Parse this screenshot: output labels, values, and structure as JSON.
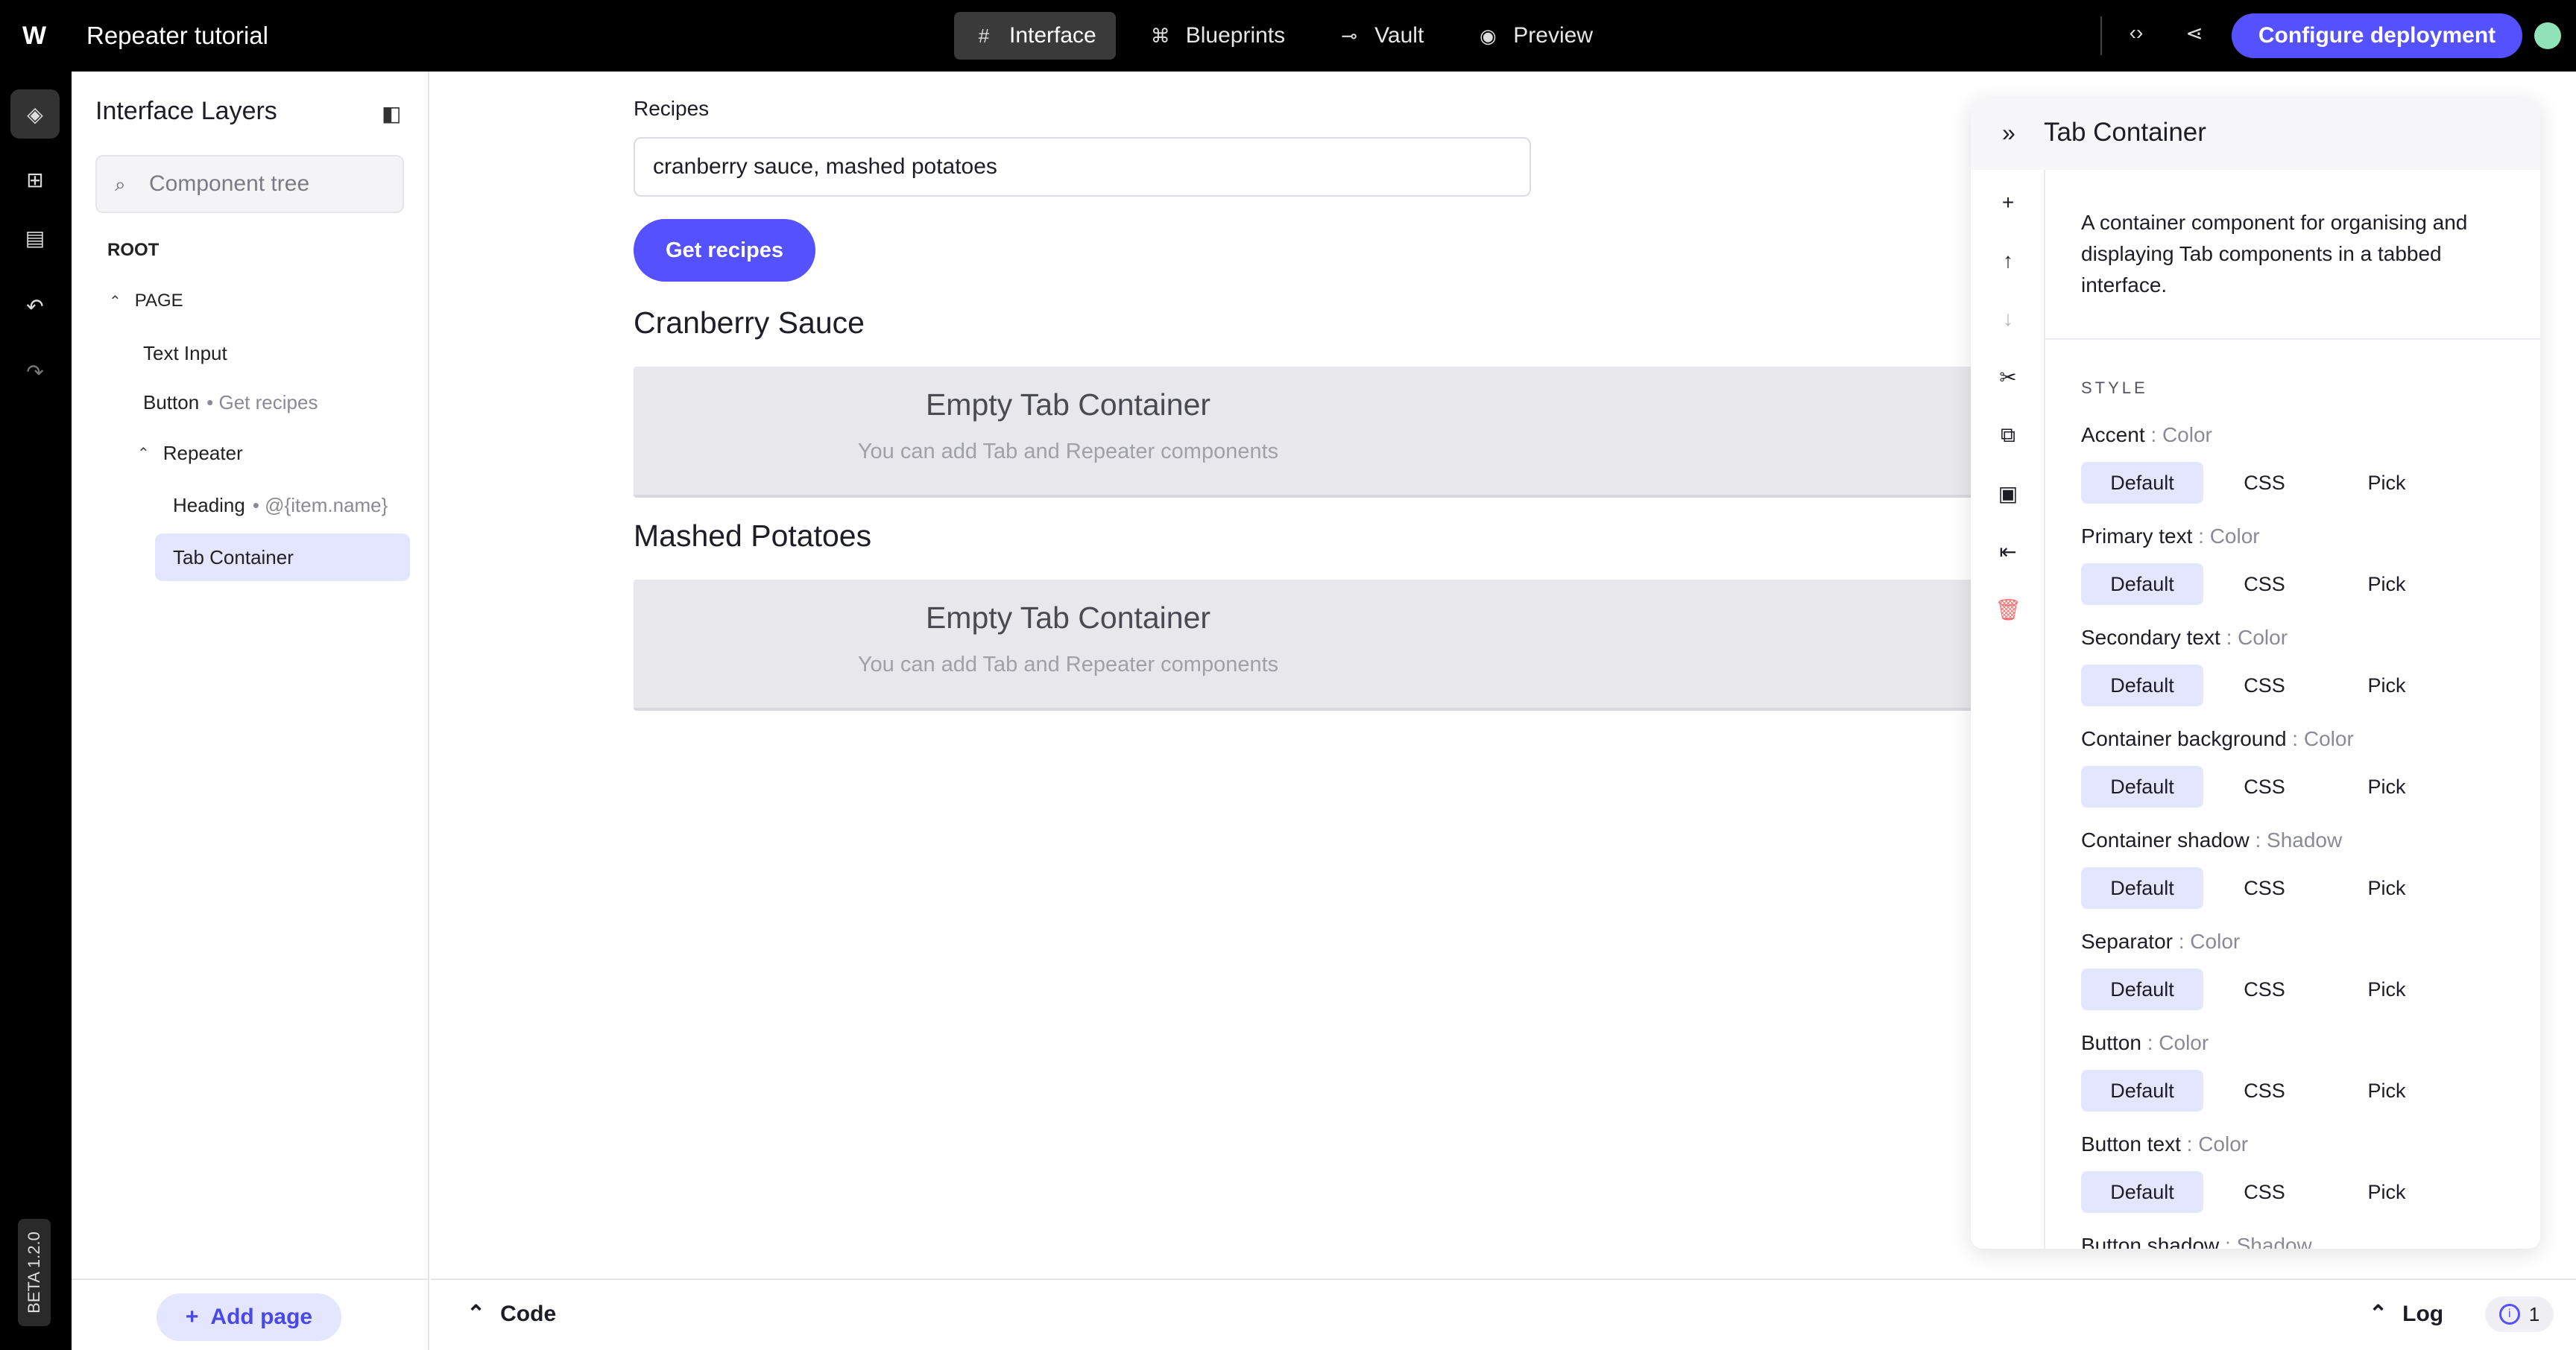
{
  "app": {
    "title": "Repeater tutorial",
    "logo": "W"
  },
  "nav": [
    {
      "label": "Interface",
      "icon": "#",
      "active": true
    },
    {
      "label": "Blueprints",
      "icon": "⌘",
      "active": false
    },
    {
      "label": "Vault",
      "icon": "⊸",
      "active": false
    },
    {
      "label": "Preview",
      "icon": "◉",
      "active": false
    }
  ],
  "topbar": {
    "code_icon": "‹›",
    "share_icon": "⋖",
    "deploy_label": "Configure deployment"
  },
  "rail": {
    "beta": "BETA 1.2.0",
    "help": "?"
  },
  "layers": {
    "title": "Interface Layers",
    "search_placeholder": "Component tree",
    "tree": {
      "root": "ROOT",
      "page": "PAGE",
      "text_input": "Text Input",
      "button": "Button",
      "button_detail": "• Get recipes",
      "repeater": "Repeater",
      "heading": "Heading",
      "heading_detail": "• @{item.name}",
      "tab_container": "Tab Container"
    },
    "add_page": "Add page"
  },
  "canvas": {
    "input_label": "Recipes",
    "input_value": "cranberry sauce, mashed potatoes",
    "button_label": "Get recipes",
    "items": [
      {
        "heading": "Cranberry Sauce",
        "empty_title": "Empty Tab Container",
        "empty_sub": "You can add Tab and Repeater components"
      },
      {
        "heading": "Mashed Potatoes",
        "empty_title": "Empty Tab Container",
        "empty_sub": "You can add Tab and Repeater components"
      }
    ]
  },
  "bottom": {
    "code": "Code",
    "log": "Log",
    "log_count": "1"
  },
  "settings": {
    "title": "Tab Container",
    "description": "A container component for organising and displaying Tab components in a tabbed interface.",
    "section": "STYLE",
    "options": [
      "Default",
      "CSS",
      "Pick"
    ],
    "properties": [
      {
        "name": "Accent",
        "type": ": Color"
      },
      {
        "name": "Primary text",
        "type": ": Color"
      },
      {
        "name": "Secondary text",
        "type": ": Color"
      },
      {
        "name": "Container background",
        "type": ": Color"
      },
      {
        "name": "Container shadow",
        "type": ": Shadow"
      },
      {
        "name": "Separator",
        "type": ": Color"
      },
      {
        "name": "Button",
        "type": ": Color"
      },
      {
        "name": "Button text",
        "type": ": Color"
      },
      {
        "name": "Button shadow",
        "type": ": Shadow"
      }
    ]
  },
  "colors": {
    "accent": "#5551ff",
    "selected": "#e4e6ff",
    "topbar": "#000000"
  }
}
